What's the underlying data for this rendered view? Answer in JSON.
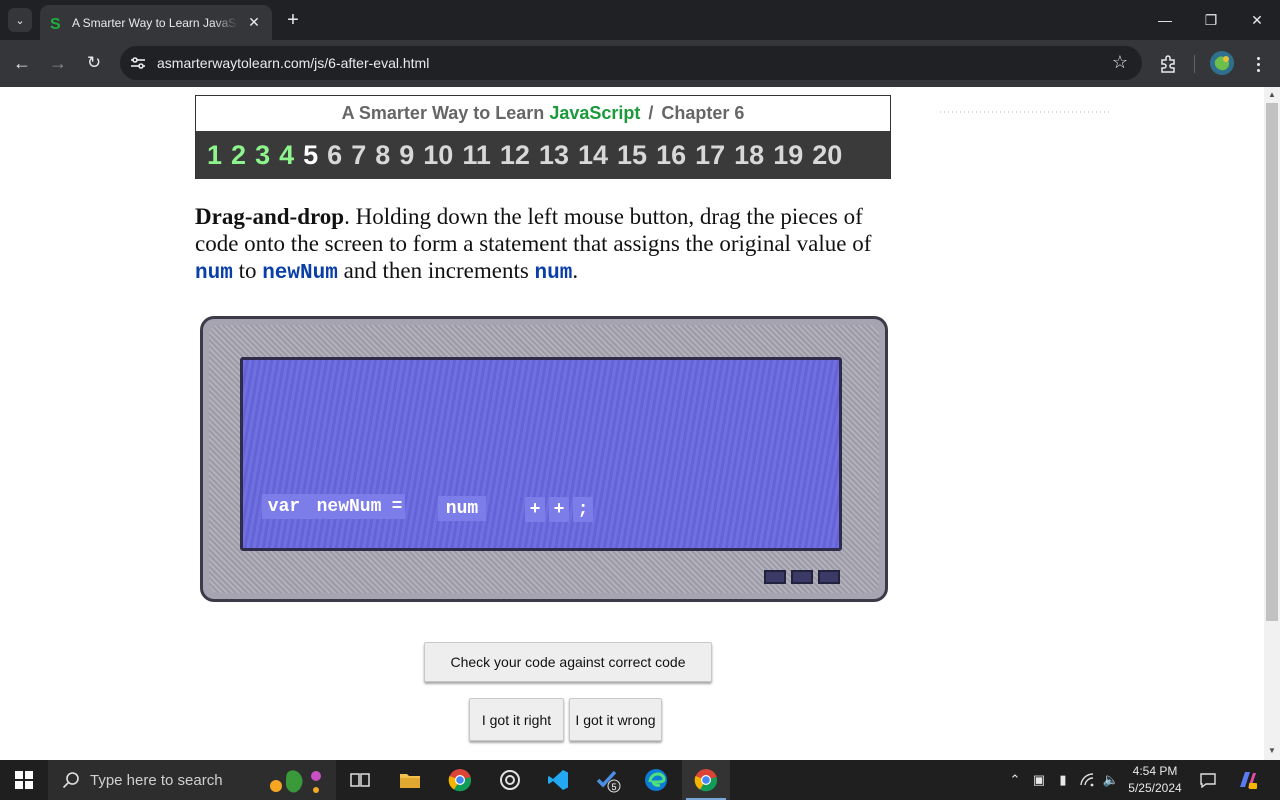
{
  "browser": {
    "tab_title": "A Smarter Way to Learn JavaScript",
    "url": "asmarterwaytolearn.com/js/6-after-eval.html",
    "tab_favicon": "green-s-icon",
    "accent_green": "#1a9a3a"
  },
  "header": {
    "title_prefix": "A Smarter Way to Learn",
    "title_js": "JavaScript",
    "separator": "/",
    "chapter_label": "Chapter 6",
    "chapters": [
      {
        "label": "1",
        "state": "done"
      },
      {
        "label": "2",
        "state": "done"
      },
      {
        "label": "3",
        "state": "done"
      },
      {
        "label": "4",
        "state": "done"
      },
      {
        "label": "5",
        "state": "current"
      },
      {
        "label": "6",
        "state": "todo"
      },
      {
        "label": "7",
        "state": "todo"
      },
      {
        "label": "8",
        "state": "todo"
      },
      {
        "label": "9",
        "state": "todo"
      },
      {
        "label": "10",
        "state": "todo"
      },
      {
        "label": "11",
        "state": "todo"
      },
      {
        "label": "12",
        "state": "todo"
      },
      {
        "label": "13",
        "state": "todo"
      },
      {
        "label": "14",
        "state": "todo"
      },
      {
        "label": "15",
        "state": "todo"
      },
      {
        "label": "16",
        "state": "todo"
      },
      {
        "label": "17",
        "state": "todo"
      },
      {
        "label": "18",
        "state": "todo"
      },
      {
        "label": "19",
        "state": "todo"
      },
      {
        "label": "20",
        "state": "todo"
      }
    ]
  },
  "prompt": {
    "lead": "Drag-and-drop",
    "text1": ". Holding down the left mouse button, drag the pieces of code onto the screen to form a statement that assigns the original value of ",
    "code1": "num",
    "text2": " to ",
    "code2": "newNum",
    "text3": " and then increments ",
    "code3": "num",
    "text4": "."
  },
  "exercise": {
    "tiles": [
      {
        "label": "var"
      },
      {
        "label": "newNum"
      },
      {
        "label": "="
      },
      {
        "label": "num"
      },
      {
        "label": "+"
      },
      {
        "label": "+"
      },
      {
        "label": ";"
      }
    ]
  },
  "buttons": {
    "check": "Check your code against correct code",
    "right": "I got it right",
    "wrong": "I got it wrong"
  },
  "taskbar": {
    "search_placeholder": "Type here to search",
    "time": "4:54 PM",
    "date": "5/25/2024",
    "badge_count": "5"
  }
}
